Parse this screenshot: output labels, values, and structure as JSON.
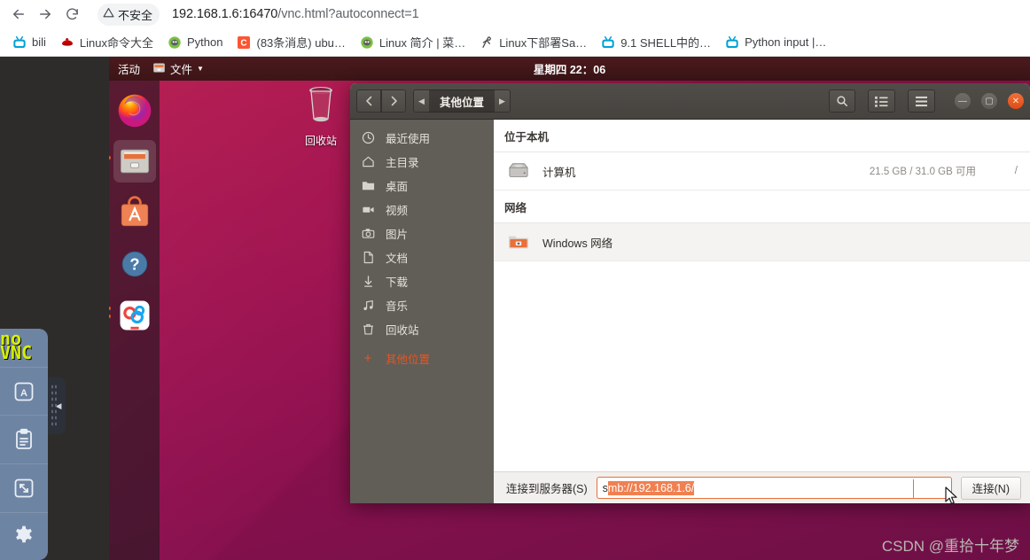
{
  "browser": {
    "nav": {
      "back_label": "Back",
      "forward_label": "Forward",
      "reload_label": "Reload"
    },
    "security_chip": {
      "icon": "warning-triangle-icon",
      "text": "不安全"
    },
    "url": {
      "host": "192.168.1.6:16470",
      "path": "/vnc.html?autoconnect=1",
      "full": "192.168.1.6:16470/vnc.html?autoconnect=1"
    },
    "bookmarks": [
      {
        "label": "bili",
        "icon": "bilibili-icon",
        "color": "#00a1d6"
      },
      {
        "label": "Linux命令大全",
        "icon": "redhat-icon",
        "color": "#cc0000"
      },
      {
        "label": "Python",
        "icon": "python-site-icon",
        "color": "#7ac143"
      },
      {
        "label": "(83条消息) ubu…",
        "icon": "csdn-icon",
        "color": "#fc5531"
      },
      {
        "label": "Linux 简介 | 菜…",
        "icon": "runoob-icon",
        "color": "#7ac143"
      },
      {
        "label": "Linux下部署Sa…",
        "icon": "site-icon",
        "color": "#4a4a4a"
      },
      {
        "label": "9.1 SHELL中的…",
        "icon": "bilibili-icon",
        "color": "#00a1d6"
      },
      {
        "label": "Python input |…",
        "icon": "bilibili-icon",
        "color": "#00a1d6"
      }
    ]
  },
  "novnc": {
    "logo_line1": "no",
    "logo_line2": "VNC",
    "buttons": [
      {
        "name": "keyboard-icon",
        "label": "A"
      },
      {
        "name": "clipboard-icon",
        "label": ""
      },
      {
        "name": "fullscreen-icon",
        "label": ""
      },
      {
        "name": "settings-gear-icon",
        "label": ""
      }
    ],
    "handle_icon": "collapse-left-arrow-icon"
  },
  "desktop": {
    "top_panel": {
      "activities": "活动",
      "app_menu": "文件",
      "app_menu_icon": "files-app-icon",
      "clock": "星期四 22：06"
    },
    "dock": [
      {
        "name": "firefox",
        "icon": "firefox-icon"
      },
      {
        "name": "files",
        "icon": "files-icon",
        "state": "active"
      },
      {
        "name": "ubuntu-software",
        "icon": "ubuntu-software-icon"
      },
      {
        "name": "help",
        "icon": "help-icon"
      },
      {
        "name": "baidu-netdisk",
        "icon": "netdisk-icon",
        "state": "running"
      }
    ],
    "trash": {
      "label": "回收站",
      "icon": "trash-icon"
    }
  },
  "files_window": {
    "nav": {
      "back_icon": "chevron-left-icon",
      "forward_icon": "chevron-right-icon",
      "crumb_left_icon": "crumb-left-arrow-icon",
      "crumb_right_icon": "crumb-right-arrow-icon",
      "breadcrumb": "其他位置"
    },
    "toolbar": {
      "search_icon": "search-icon",
      "view_icon": "list-view-icon",
      "menu_icon": "hamburger-menu-icon",
      "minimize_icon": "minimize-icon",
      "maximize_icon": "maximize-icon",
      "close_icon": "close-icon"
    },
    "sidebar": [
      {
        "label": "最近使用",
        "icon": "clock-icon"
      },
      {
        "label": "主目录",
        "icon": "home-icon"
      },
      {
        "label": "桌面",
        "icon": "desktop-folder-icon"
      },
      {
        "label": "视频",
        "icon": "video-icon"
      },
      {
        "label": "图片",
        "icon": "camera-icon"
      },
      {
        "label": "文档",
        "icon": "document-icon"
      },
      {
        "label": "下载",
        "icon": "download-icon"
      },
      {
        "label": "音乐",
        "icon": "music-icon"
      },
      {
        "label": "回收站",
        "icon": "trash-icon"
      },
      {
        "label": "其他位置",
        "icon": "plus-icon",
        "selected": true
      }
    ],
    "groups": [
      {
        "header": "位于本机",
        "rows": [
          {
            "name": "计算机",
            "icon": "hard-drive-icon",
            "free": "21.5 GB / 31.0 GB 可用",
            "mount": "/"
          }
        ]
      },
      {
        "header": "网络",
        "rows": [
          {
            "name": "Windows 网络",
            "icon": "network-folder-icon",
            "free": "",
            "mount": "",
            "hovered": true
          }
        ]
      }
    ],
    "footer": {
      "label": "连接到服务器(S)",
      "input_prefix": "s",
      "input_selected": "mb://192.168.1.6/",
      "input_value": "smb://192.168.1.6/",
      "connect_label": "连接(N)"
    }
  },
  "watermark": "CSDN @重拾十年梦",
  "colors": {
    "ubuntu_orange": "#e95420",
    "panel_dark": "#3c1517",
    "sidebar_gray": "#615e57",
    "novnc_blue": "#6e84a3",
    "novnc_yellow": "#d7f000"
  }
}
